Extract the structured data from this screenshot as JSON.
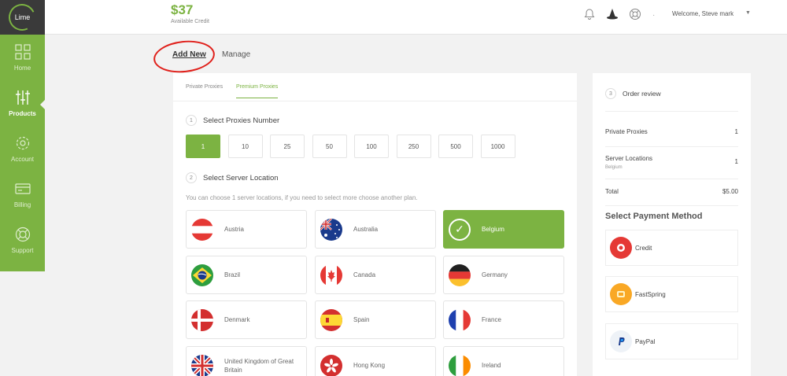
{
  "brand": {
    "logo": "Lime",
    "accent": "#7cb342"
  },
  "sidebar": {
    "items": [
      {
        "label": "Home",
        "icon": "grid-icon"
      },
      {
        "label": "Products",
        "icon": "sliders-icon"
      },
      {
        "label": "Account",
        "icon": "gear-icon"
      },
      {
        "label": "Billing",
        "icon": "card-icon"
      },
      {
        "label": "Support",
        "icon": "lifebuoy-icon"
      }
    ]
  },
  "header": {
    "credit_amount": "$37",
    "credit_label": "Available Credit",
    "welcome": "Welcome, Steve mark",
    "separator": "·"
  },
  "tabs": {
    "add_new": "Add New",
    "manage": "Manage"
  },
  "subtabs": {
    "private": "Private Proxies",
    "premium": "Premium Proxies"
  },
  "step1": {
    "num": "1",
    "title": "Select Proxies Number"
  },
  "quantities": [
    "1",
    "10",
    "25",
    "50",
    "100",
    "250",
    "500",
    "1000"
  ],
  "step2": {
    "num": "2",
    "title": "Select Server Location"
  },
  "location_hint": "You can choose 1 server locations, if you need to select more choose another plan.",
  "locations": [
    {
      "name": "Austria"
    },
    {
      "name": "Australia"
    },
    {
      "name": "Belgium",
      "selected": true
    },
    {
      "name": "Brazil"
    },
    {
      "name": "Canada"
    },
    {
      "name": "Germany"
    },
    {
      "name": "Denmark"
    },
    {
      "name": "Spain"
    },
    {
      "name": "France"
    },
    {
      "name": "United Kingdom of Great Britain"
    },
    {
      "name": "Hong Kong"
    },
    {
      "name": "Ireland"
    }
  ],
  "review": {
    "num": "3",
    "title": "Order review",
    "private_label": "Private Proxies",
    "private_value": "1",
    "server_label": "Server Locations",
    "server_sub": "Belgium",
    "server_value": "1",
    "total_label": "Total",
    "total_value": "$5.00",
    "payment_title": "Select Payment Method",
    "payments": [
      "Credit",
      "FastSpring",
      "PayPal"
    ]
  }
}
